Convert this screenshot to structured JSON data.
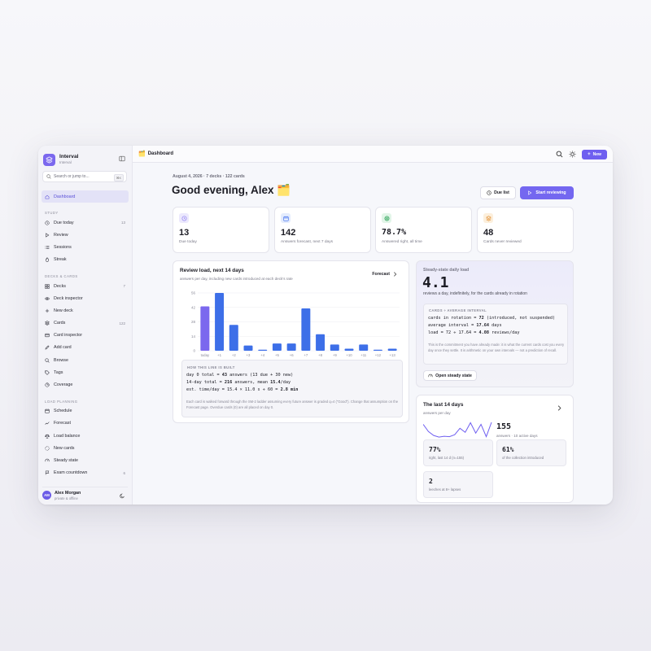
{
  "app": {
    "name": "Interval",
    "sub": "Interval"
  },
  "search": {
    "placeholder": "Search or jump to...",
    "shortcut": "⌘K"
  },
  "sidebar": {
    "top": [
      {
        "label": "Dashboard",
        "icon": "home-icon"
      }
    ],
    "sections": [
      {
        "title": "STUDY",
        "items": [
          {
            "label": "Due today",
            "icon": "clock-icon",
            "count": "13"
          },
          {
            "label": "Review",
            "icon": "play-icon",
            "count": ""
          },
          {
            "label": "Sessions",
            "icon": "list-icon",
            "count": ""
          },
          {
            "label": "Streak",
            "icon": "flame-icon",
            "count": ""
          }
        ]
      },
      {
        "title": "DECKS & CARDS",
        "items": [
          {
            "label": "Decks",
            "icon": "grid-icon",
            "count": "7"
          },
          {
            "label": "Deck inspector",
            "icon": "eye-icon",
            "count": ""
          },
          {
            "label": "New deck",
            "icon": "plus-icon",
            "count": ""
          },
          {
            "label": "Cards",
            "icon": "layers-icon",
            "count": "122"
          },
          {
            "label": "Card inspector",
            "icon": "card-icon",
            "count": ""
          },
          {
            "label": "Add card",
            "icon": "edit-icon",
            "count": ""
          },
          {
            "label": "Browse",
            "icon": "search-icon",
            "count": ""
          },
          {
            "label": "Tags",
            "icon": "tag-icon",
            "count": ""
          },
          {
            "label": "Coverage",
            "icon": "pie-icon",
            "count": ""
          }
        ]
      },
      {
        "title": "LOAD PLANNING",
        "items": [
          {
            "label": "Schedule",
            "icon": "calendar-icon",
            "count": ""
          },
          {
            "label": "Forecast",
            "icon": "trend-icon",
            "count": ""
          },
          {
            "label": "Load balance",
            "icon": "scale-icon",
            "count": ""
          },
          {
            "label": "New cards",
            "icon": "sparkle-icon",
            "count": ""
          },
          {
            "label": "Steady state",
            "icon": "gauge-icon",
            "count": ""
          },
          {
            "label": "Exam countdown",
            "icon": "flag-icon",
            "count": "6"
          }
        ]
      }
    ]
  },
  "user": {
    "initials": "AM",
    "name": "Alex Morgan",
    "sub": "private & offline"
  },
  "topbar": {
    "emoji": "🗂️",
    "title": "Dashboard",
    "new_label": "New"
  },
  "header": {
    "meta": "August 4, 2026 · 7 decks · 122 cards",
    "greeting": "Good evening, Alex 🗂️",
    "due_list": "Due list",
    "start": "Start reviewing"
  },
  "stats": [
    {
      "value": "13",
      "label": "Due today",
      "icon": "clock-icon",
      "color": "#8b7cf0",
      "bg": "#ece9fd"
    },
    {
      "value": "142",
      "label": "Answers forecast, next 7 days",
      "icon": "calendar-icon",
      "color": "#3b6cf0",
      "bg": "#e4ecfd"
    },
    {
      "value": "78.7%",
      "label": "Answered right, all time",
      "icon": "target-icon",
      "color": "#2fa55a",
      "bg": "#e2f5e8"
    },
    {
      "value": "48",
      "label": "Cards never reviewed",
      "icon": "layers-icon",
      "color": "#e08a2a",
      "bg": "#fcefdc"
    }
  ],
  "review_load": {
    "title": "Review load, next 14 days",
    "sub": "answers per day, including new cards introduced at each deck's rate",
    "forecast_link": "Forecast",
    "how_title": "HOW THIS LINE IS BUILT",
    "lines": [
      [
        "day 0 total = ",
        "43",
        " answers (13 due + 30 new)"
      ],
      [
        "14-day total = ",
        "216",
        " answers, mean ",
        "15.4",
        "/day"
      ],
      [
        "est. time/day = 15.4 × 11.0 s ÷ 60 = ",
        "2.8 min",
        ""
      ]
    ],
    "note": "Each card is walked forward through the SM-2 ladder assuming every future answer is graded q=4 (\"Good\"). Change that assumption on the Forecast page. Overdue cards (0) are all placed on day 0."
  },
  "chart_data": {
    "type": "bar",
    "categories": [
      "today",
      "+1",
      "+2",
      "+3",
      "+4",
      "+5",
      "+6",
      "+7",
      "+8",
      "+9",
      "+10",
      "+11",
      "+12",
      "+13"
    ],
    "values": [
      43,
      56,
      25,
      5,
      1,
      7,
      7,
      41,
      16,
      6,
      2,
      6,
      1,
      2
    ],
    "yticks": [
      0,
      14,
      28,
      42,
      56
    ],
    "ylim": [
      0,
      56
    ],
    "colors": {
      "today": "#7b68ee",
      "other": "#3d6fe8"
    },
    "grid": true
  },
  "steady": {
    "label": "Steady-state daily load",
    "value": "4.1",
    "sub": "reviews a day, indefinitely, for the cards already in rotation",
    "box_title": "CARDS ÷ AVERAGE INTERVAL",
    "lines": [
      [
        "cards in rotation = ",
        "72",
        " (introduced, not suspended)"
      ],
      [
        "average interval = ",
        "17.64",
        " days"
      ],
      [
        "load = 72 ÷ 17.64 = ",
        "4.08",
        " reviews/day"
      ]
    ],
    "note": "This is the commitment you have already made: it is what the current cards cost you every day once they settle. It is arithmetic on your own intervals — not a prediction of recall.",
    "button": "Open steady state"
  },
  "last14": {
    "title": "The last 14 days",
    "sub": "answers per day",
    "spark": [
      40,
      22,
      12,
      8,
      10,
      9,
      14,
      30,
      20,
      44,
      18,
      40,
      9,
      45
    ],
    "total": "155",
    "total_sub": "answers · 10 active days",
    "tiles": [
      {
        "value": "77%",
        "label": "right, last 14 d (n=155)"
      },
      {
        "value": "61%",
        "label": "of the collection introduced"
      },
      {
        "value": "2",
        "label": "leeches at 8+ lapses"
      }
    ]
  }
}
